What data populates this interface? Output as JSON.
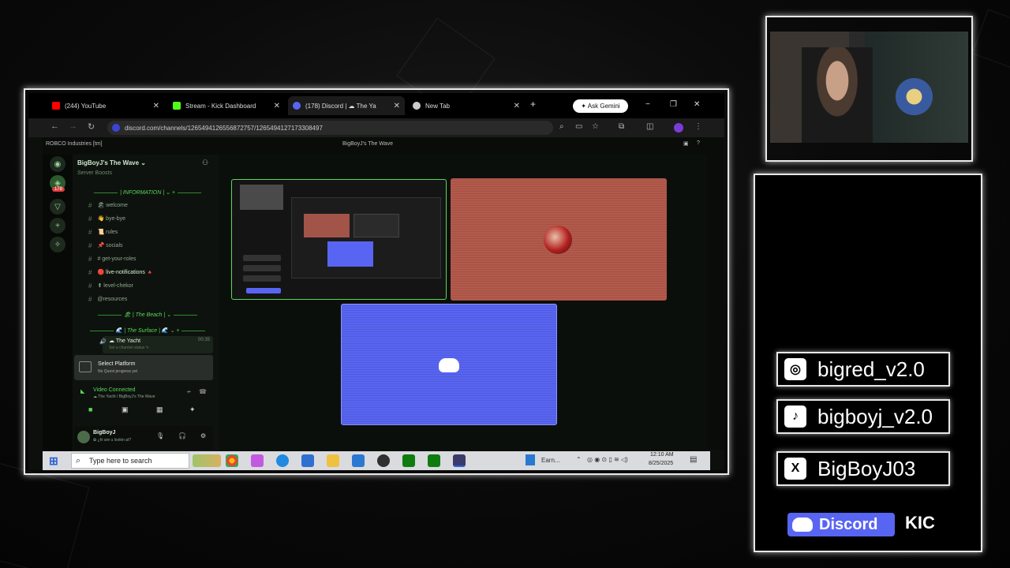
{
  "browser": {
    "tabs": [
      {
        "label": "(244) YouTube",
        "color": "#ff0000"
      },
      {
        "label": "Stream - Kick Dashboard",
        "color": "#53fc18"
      },
      {
        "label": "(178) Discord | ☁ The Ya",
        "color": "#5865f2"
      },
      {
        "label": "New Tab",
        "color": "#cccccc"
      }
    ],
    "new_tab_icon": "+",
    "ask_label": "✦ Ask Gemini",
    "minimize_icon": "−",
    "restore_icon": "❐",
    "close_icon": "✕",
    "url": "discord.com/channels/1265494126556872757/1265494127173308497"
  },
  "discord": {
    "window_title": "ROBCO Industries [tm]",
    "channel_title": "BigBoyJ's The Wave",
    "unread_badge": "178",
    "server": {
      "name": "BigBoyJ's The Wave ⌄",
      "boosts": "Server Boosts"
    },
    "categories": {
      "information": "| INFORMATION | ⌄ +",
      "beach": "🏖 | The Beach | ⌄",
      "surface": "🌊 | The Surface | 🌊 ⌄ +"
    },
    "channels": [
      {
        "label": "🏖 welcome"
      },
      {
        "label": "👋 bye-bye"
      },
      {
        "label": "📜 rules"
      },
      {
        "label": "📌 socials"
      },
      {
        "label": "# get-your-roles"
      },
      {
        "label": "🔴 live-notifications 🔺"
      },
      {
        "label": "⬆ level-chekor"
      },
      {
        "label": "@resources"
      }
    ],
    "voice_channel": "☁ The Yacht",
    "voice_time": "00:35",
    "voice_status": "Set a channel status ✎",
    "platform": {
      "title": "Select Platform",
      "subtitle": "No Quest progress yet"
    },
    "video": {
      "status": "Video Connected",
      "location": "☁ The Yacht / BigBoyJ's The Wave"
    },
    "user": {
      "name": "BigBoyJ",
      "status": "✿ ¿hi are u lookin at?"
    }
  },
  "taskbar": {
    "search_placeholder": "Type here to search",
    "weather": "Earn...",
    "time": "12:10 AM",
    "date": "8/25/2025"
  },
  "socials": [
    {
      "icon": "instagram-icon",
      "glyph": "◎",
      "handle": "bigred_v2.0"
    },
    {
      "icon": "tiktok-icon",
      "glyph": "♪",
      "handle": "bigboyj_v2.0"
    },
    {
      "icon": "x-icon",
      "glyph": "X",
      "handle": "BigBoyJ03"
    }
  ],
  "logos": {
    "discord": "Discord",
    "kick": "KIC"
  },
  "colors": {
    "accent_green": "#57d957",
    "discord_blurple": "#5865f2",
    "tile_red": "#b35a4c"
  }
}
